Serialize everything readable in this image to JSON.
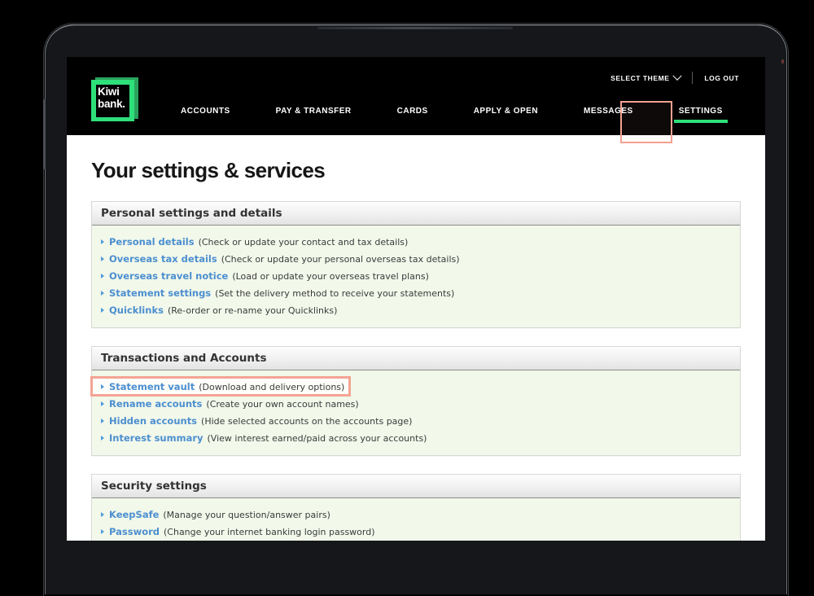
{
  "header": {
    "logo": {
      "name": "kiwibank-logo",
      "text": "Kiwi\nbank.",
      "green": "#2ee07a"
    },
    "utility": [
      {
        "label": "SELECT THEME",
        "icon": "chevron-down-icon",
        "has_chevron": true
      },
      {
        "label": "LOG OUT",
        "has_chevron": false
      }
    ],
    "nav": [
      {
        "label": "ACCOUNTS",
        "active": false
      },
      {
        "label": "PAY & TRANSFER",
        "active": false
      },
      {
        "label": "CARDS",
        "active": false
      },
      {
        "label": "APPLY & OPEN",
        "active": false
      },
      {
        "label": "MESSAGES",
        "active": false
      },
      {
        "label": "SETTINGS",
        "active": true
      }
    ]
  },
  "page": {
    "title": "Your settings & services"
  },
  "highlight_color": "#f4a493",
  "sections": [
    {
      "title": "Personal settings and details",
      "rows": [
        {
          "link": "Personal details",
          "desc": "(Check or update your contact and tax details)",
          "highlighted": false
        },
        {
          "link": "Overseas tax details",
          "desc": "(Check or update your personal overseas tax details)",
          "highlighted": false
        },
        {
          "link": "Overseas travel notice",
          "desc": "(Load or update your overseas travel plans)",
          "highlighted": false
        },
        {
          "link": "Statement settings",
          "desc": "(Set the delivery method to receive your statements)",
          "highlighted": false
        },
        {
          "link": "Quicklinks",
          "desc": "(Re-order or re-name your Quicklinks)",
          "highlighted": false
        }
      ]
    },
    {
      "title": "Transactions and Accounts",
      "rows": [
        {
          "link": "Statement vault",
          "desc": "(Download and delivery options)",
          "highlighted": true
        },
        {
          "link": "Rename accounts",
          "desc": "(Create your own account names)",
          "highlighted": false
        },
        {
          "link": "Hidden accounts",
          "desc": "(Hide selected accounts on the accounts page)",
          "highlighted": false
        },
        {
          "link": "Interest summary",
          "desc": "(View interest earned/paid across your accounts)",
          "highlighted": false
        }
      ]
    },
    {
      "title": "Security settings",
      "rows": [
        {
          "link": "KeepSafe",
          "desc": "(Manage your question/answer pairs)",
          "highlighted": false
        },
        {
          "link": "Password",
          "desc": "(Change your internet banking login password)",
          "highlighted": false
        }
      ]
    }
  ]
}
